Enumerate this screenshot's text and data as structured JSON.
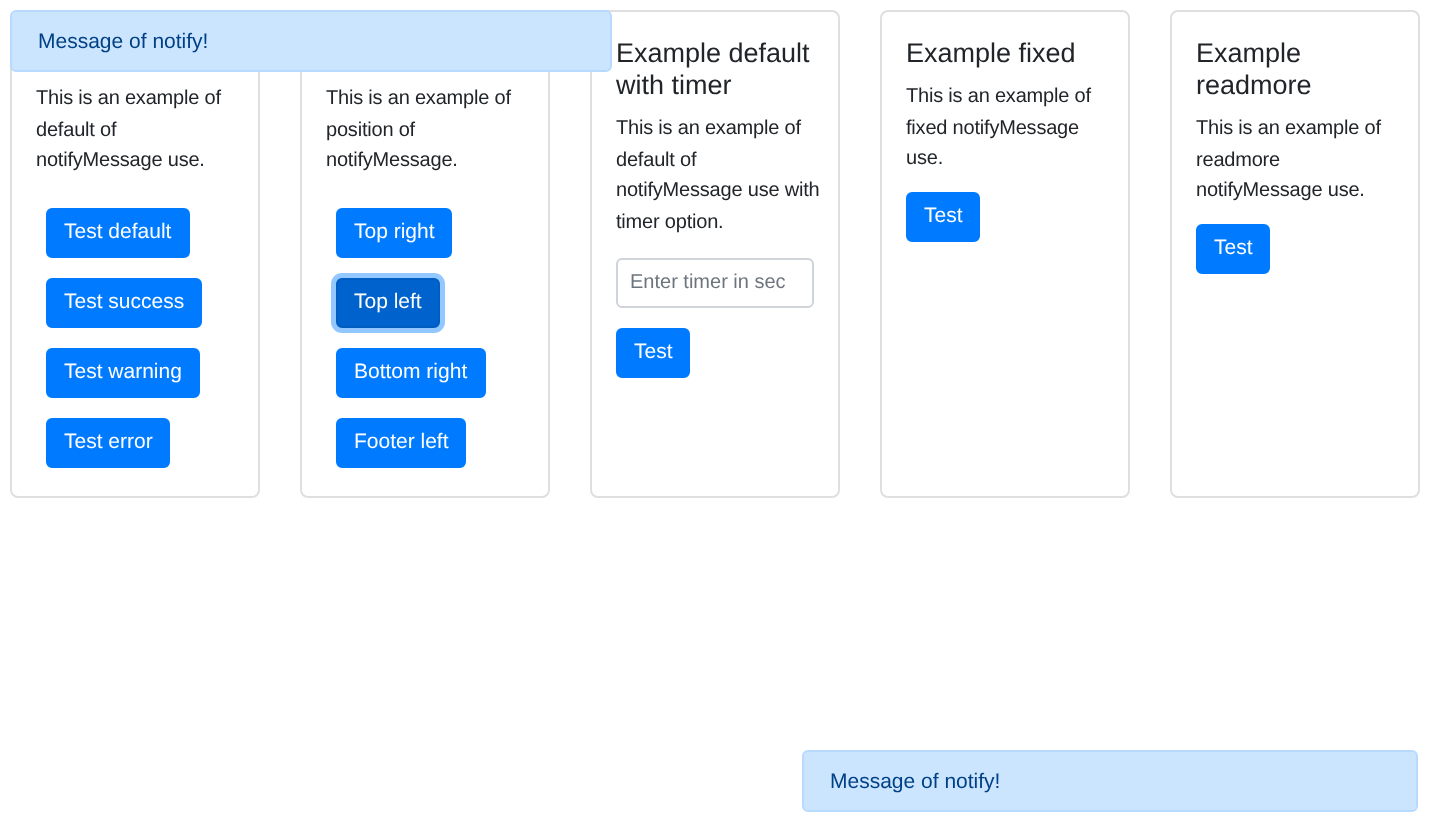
{
  "cards": [
    {
      "text": "This is an example of default of notifyMessage use.",
      "buttons": [
        {
          "label": "Test default",
          "focused": false
        },
        {
          "label": "Test success",
          "focused": false
        },
        {
          "label": "Test warning",
          "focused": false
        },
        {
          "label": "Test error",
          "focused": false
        }
      ]
    },
    {
      "text": "This is an example of position of notifyMessage.",
      "buttons": [
        {
          "label": "Top right",
          "focused": false
        },
        {
          "label": "Top left",
          "focused": true
        },
        {
          "label": "Bottom right",
          "focused": false
        },
        {
          "label": "Footer left",
          "focused": false
        }
      ]
    },
    {
      "title": "Example default with timer",
      "text": "This is an example of default of notifyMessage use with timer option.",
      "input": {
        "placeholder": "Enter timer in sec"
      },
      "buttons": [
        {
          "label": "Test",
          "focused": false
        }
      ]
    },
    {
      "title": "Example fixed",
      "text": "This is an example of fixed notifyMessage use.",
      "buttons": [
        {
          "label": "Test",
          "focused": false
        }
      ]
    },
    {
      "title": "Example readmore",
      "text": "This is an example of readmore notifyMessage use.",
      "buttons": [
        {
          "label": "Test",
          "focused": false
        }
      ]
    }
  ],
  "top_notification": {
    "text": "Message of notify!"
  },
  "bottom_notification": {
    "text": "Message of notify!"
  }
}
